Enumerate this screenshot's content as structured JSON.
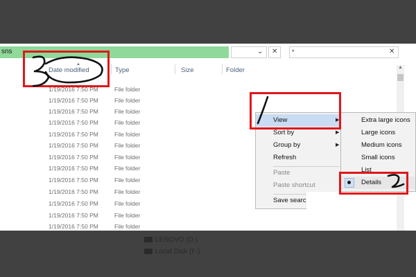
{
  "explorer": {
    "address_text": "sns",
    "search_text": "*",
    "columns": [
      "Date modified",
      "Type",
      "Size",
      "Folder"
    ],
    "rows": [
      {
        "date": "1/19/2016 7:50 PM",
        "type": "File folder"
      },
      {
        "date": "1/19/2016 7:50 PM",
        "type": "File folder"
      },
      {
        "date": "1/19/2016 7:50 PM",
        "type": "File folder"
      },
      {
        "date": "1/19/2016 7:50 PM",
        "type": "File folder"
      },
      {
        "date": "1/19/2016 7:50 PM",
        "type": "File folder"
      },
      {
        "date": "1/19/2016 7:50 PM",
        "type": "File folder"
      },
      {
        "date": "1/19/2016 7:50 PM",
        "type": "File folder"
      },
      {
        "date": "1/19/2016 7:50 PM",
        "type": "File folder"
      },
      {
        "date": "1/19/2016 7:50 PM",
        "type": "File folder"
      },
      {
        "date": "1/19/2016 7:50 PM",
        "type": "File folder"
      },
      {
        "date": "1/19/2016 7:50 PM",
        "type": "File folder"
      },
      {
        "date": "1/19/2016 7:50 PM",
        "type": "File folder"
      },
      {
        "date": "1/19/2016 7:50 PM",
        "type": "File folder"
      }
    ]
  },
  "context_menu": {
    "items": [
      {
        "label": "View",
        "has_submenu": true,
        "highlighted": true,
        "disabled": false
      },
      {
        "label": "Sort by",
        "has_submenu": true,
        "highlighted": false,
        "disabled": false
      },
      {
        "label": "Group by",
        "has_submenu": true,
        "highlighted": false,
        "disabled": false
      },
      {
        "label": "Refresh",
        "has_submenu": false,
        "highlighted": false,
        "disabled": false
      },
      {
        "label": "Paste",
        "has_submenu": false,
        "highlighted": false,
        "disabled": true
      },
      {
        "label": "Paste shortcut",
        "has_submenu": false,
        "highlighted": false,
        "disabled": true
      },
      {
        "label": "Save search",
        "has_submenu": false,
        "highlighted": false,
        "disabled": false
      }
    ]
  },
  "view_submenu": {
    "items": [
      {
        "label": "Extra large icons",
        "selected": false
      },
      {
        "label": "Large icons",
        "selected": false
      },
      {
        "label": "Medium icons",
        "selected": false
      },
      {
        "label": "Small icons",
        "selected": false
      },
      {
        "label": "List",
        "selected": false
      },
      {
        "label": "Details",
        "selected": true
      }
    ]
  },
  "drives": [
    {
      "label": "LENOVO (D:)"
    },
    {
      "label": "Local Disk (F:)"
    }
  ],
  "colors": {
    "address_bar": "#8fd99a",
    "annotation_red": "#e0161a",
    "menu_highlight": "#c9dcf3",
    "background_dark": "#414141"
  }
}
